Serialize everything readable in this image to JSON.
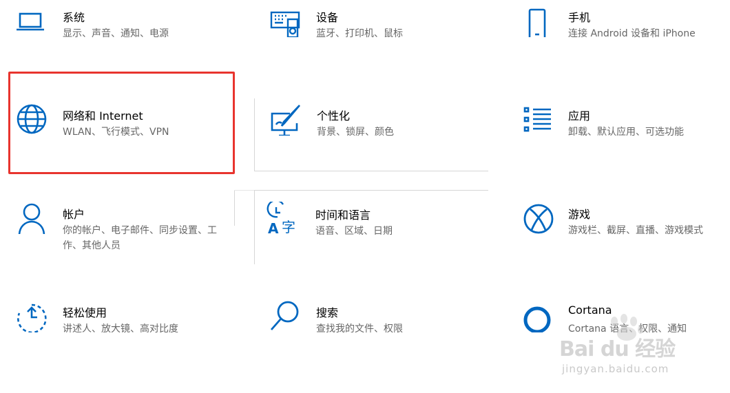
{
  "accent_color": "#0067c0",
  "highlight_color": "#e8342e",
  "tiles": [
    {
      "title": "系统",
      "desc": "显示、声音、通知、电源",
      "icon": "laptop-icon"
    },
    {
      "title": "设备",
      "desc": "蓝牙、打印机、鼠标",
      "icon": "devices-icon"
    },
    {
      "title": "手机",
      "desc": "连接 Android 设备和 iPhone",
      "icon": "phone-icon"
    },
    {
      "title": "网络和 Internet",
      "desc": "WLAN、飞行模式、VPN",
      "icon": "globe-icon"
    },
    {
      "title": "个性化",
      "desc": "背景、锁屏、颜色",
      "icon": "personalization-icon"
    },
    {
      "title": "应用",
      "desc": "卸载、默认应用、可选功能",
      "icon": "apps-list-icon"
    },
    {
      "title": "帐户",
      "desc": "你的帐户、电子邮件、同步设置、工作、其他人员",
      "icon": "person-icon"
    },
    {
      "title": "时间和语言",
      "desc": "语音、区域、日期",
      "icon": "time-language-icon"
    },
    {
      "title": "游戏",
      "desc": "游戏栏、截屏、直播、游戏模式",
      "icon": "xbox-icon"
    },
    {
      "title": "轻松使用",
      "desc": "讲述人、放大镜、高对比度",
      "icon": "ease-of-access-icon"
    },
    {
      "title": "搜索",
      "desc": "查找我的文件、权限",
      "icon": "search-icon"
    },
    {
      "title": "Cortana",
      "desc": "Cortana 语言、权限、通知",
      "icon": "cortana-icon"
    }
  ],
  "watermark": {
    "logo": "Bai du 经验",
    "url": "jingyan.baidu.com"
  }
}
